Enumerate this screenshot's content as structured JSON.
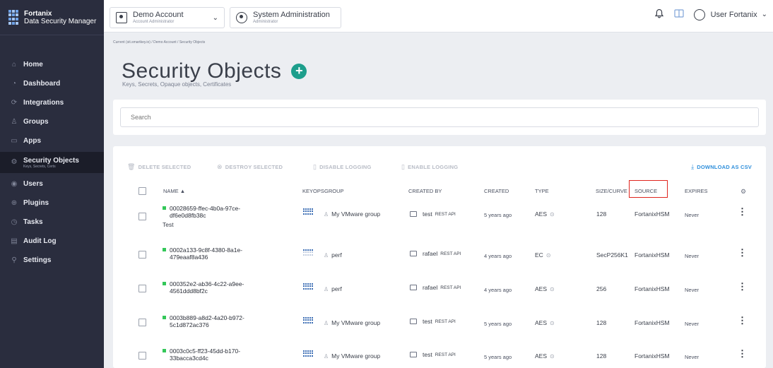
{
  "brand": {
    "line1": "Fortanix",
    "line2": "Data Security Manager"
  },
  "sidebar": {
    "items": [
      {
        "label": "Home",
        "icon": "home-icon",
        "glyph": "⌂"
      },
      {
        "label": "Dashboard",
        "icon": "dashboard-icon",
        "glyph": "◔"
      },
      {
        "label": "Integrations",
        "icon": "integrations-icon",
        "glyph": "⟳"
      },
      {
        "label": "Groups",
        "icon": "groups-icon",
        "glyph": "♙"
      },
      {
        "label": "Apps",
        "icon": "apps-icon",
        "glyph": "▭"
      },
      {
        "label": "Security Objects",
        "sublabel": "Keys, Secrets, Certs",
        "icon": "security-objects-icon",
        "glyph": "⚙"
      },
      {
        "label": "Users",
        "icon": "users-icon",
        "glyph": "◉"
      },
      {
        "label": "Plugins",
        "icon": "plugins-icon",
        "glyph": "⊕"
      },
      {
        "label": "Tasks",
        "icon": "tasks-icon",
        "glyph": "◷"
      },
      {
        "label": "Audit Log",
        "icon": "audit-log-icon",
        "glyph": "▤"
      },
      {
        "label": "Settings",
        "icon": "settings-icon",
        "glyph": "⚲"
      }
    ]
  },
  "header": {
    "account": {
      "name": "Demo Account",
      "role": "Account Administrator",
      "chevron": "⌄"
    },
    "sysadmin": {
      "name": "System Administration",
      "role": "Administrator"
    },
    "user": "User Fortanix",
    "user_chevron": "⌄",
    "bell": "♫",
    "bell_icon": "bell-icon"
  },
  "breadcrumb": "Current (sit.smartkey.io) / Demo Account / Security Objects",
  "page": {
    "title": "Security Objects",
    "add_glyph": "+",
    "subtitle": "Keys, Secrets, Opaque objects, Certificates"
  },
  "search": {
    "placeholder": "Search"
  },
  "actions": {
    "delete": "DELETE SELECTED",
    "destroy": "DESTROY SELECTED",
    "disable": "DISABLE LOGGING",
    "enable": "ENABLE LOGGING",
    "download": "DOWNLOAD AS CSV"
  },
  "columns": {
    "name": "NAME ▲",
    "keyops": "KEYOPS",
    "group": "GROUP",
    "created_by": "CREATED BY",
    "created": "CREATED",
    "type": "TYPE",
    "size": "SIZE/CURVE",
    "source": "SOURCE",
    "expires": "EXPIRES",
    "settings_glyph": "⚙"
  },
  "rows": [
    {
      "name": "00028659-ffec-4b0a-97ce-df6e0d8fb38c",
      "desc": "Test",
      "group": "My VMware group",
      "created_by": "test",
      "api": "REST API",
      "created": "5 years ago",
      "type": "AES",
      "size": "128",
      "source": "FortanixHSM",
      "expires": "Never"
    },
    {
      "name": "0002a133-9c8f-4380-8a1e-479eaaf8a436",
      "desc": "",
      "group": "perf",
      "created_by": "rafael",
      "api": "REST API",
      "created": "4 years ago",
      "type": "EC",
      "size": "SecP256K1",
      "source": "FortanixHSM",
      "expires": "Never"
    },
    {
      "name": "000352e2-ab36-4c22-a9ee-4561ddd8bf2c",
      "desc": "",
      "group": "perf",
      "created_by": "rafael",
      "api": "REST API",
      "created": "4 years ago",
      "type": "AES",
      "size": "256",
      "source": "FortanixHSM",
      "expires": "Never"
    },
    {
      "name": "0003b889-a8d2-4a20-b972-5c1d872ac376",
      "desc": "",
      "group": "My VMware group",
      "created_by": "test",
      "api": "REST API",
      "created": "5 years ago",
      "type": "AES",
      "size": "128",
      "source": "FortanixHSM",
      "expires": "Never"
    },
    {
      "name": "0003c0c5-ff23-45dd-b170-33bacca3cd4c",
      "desc": "",
      "group": "My VMware group",
      "created_by": "test",
      "api": "REST API",
      "created": "5 years ago",
      "type": "AES",
      "size": "128",
      "source": "FortanixHSM",
      "expires": "Never"
    }
  ],
  "colors": {
    "sidebar": "#2a2d3e",
    "accent": "#1d9e8c",
    "link": "#2f8fdb",
    "status": "#34c759",
    "highlight": "#e0251e"
  }
}
